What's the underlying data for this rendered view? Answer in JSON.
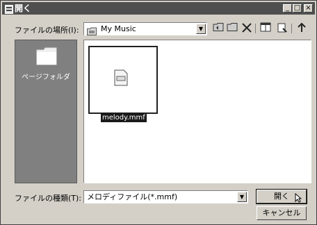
{
  "window": {
    "title": "開く",
    "controls": {
      "minimize": "_",
      "maximize": "□",
      "close": "×"
    }
  },
  "toolbar": {
    "look_in_label": "ファイルの場所(I):",
    "look_in_value": "My Music",
    "buttons": [
      "back-folder-icon",
      "up-folder-icon",
      "new-folder-icon",
      "delete-icon",
      "view-menu-icon",
      "tools-icon"
    ]
  },
  "places": [
    {
      "label": "ページフォルダ",
      "icon": "folder-icon"
    }
  ],
  "files": [
    {
      "name": "melody.mmf",
      "icon": "mmf-file-icon",
      "selected": true
    }
  ],
  "filetype": {
    "label": "ファイルの種類(T):",
    "value": "メロディファイル(*.mmf)"
  },
  "buttons": {
    "open": "開く",
    "cancel": "キャンセル"
  }
}
